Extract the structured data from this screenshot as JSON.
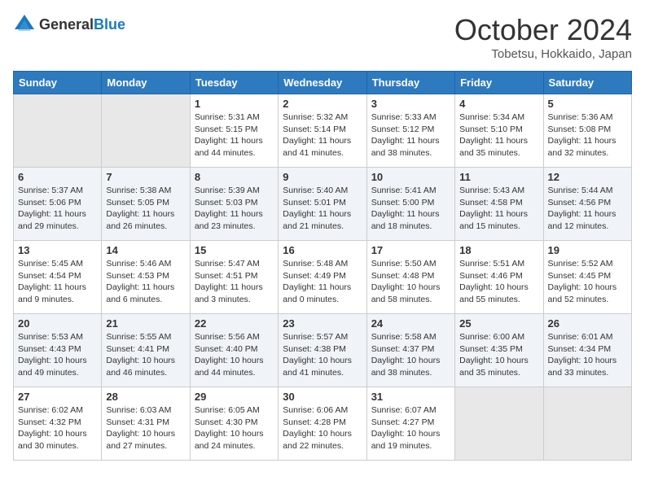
{
  "header": {
    "logo": {
      "general": "General",
      "blue": "Blue"
    },
    "title": "October 2024",
    "location": "Tobetsu, Hokkaido, Japan"
  },
  "weekdays": [
    "Sunday",
    "Monday",
    "Tuesday",
    "Wednesday",
    "Thursday",
    "Friday",
    "Saturday"
  ],
  "weeks": [
    [
      {
        "day": "",
        "info": ""
      },
      {
        "day": "",
        "info": ""
      },
      {
        "day": "1",
        "info": "Sunrise: 5:31 AM\nSunset: 5:15 PM\nDaylight: 11 hours and 44 minutes."
      },
      {
        "day": "2",
        "info": "Sunrise: 5:32 AM\nSunset: 5:14 PM\nDaylight: 11 hours and 41 minutes."
      },
      {
        "day": "3",
        "info": "Sunrise: 5:33 AM\nSunset: 5:12 PM\nDaylight: 11 hours and 38 minutes."
      },
      {
        "day": "4",
        "info": "Sunrise: 5:34 AM\nSunset: 5:10 PM\nDaylight: 11 hours and 35 minutes."
      },
      {
        "day": "5",
        "info": "Sunrise: 5:36 AM\nSunset: 5:08 PM\nDaylight: 11 hours and 32 minutes."
      }
    ],
    [
      {
        "day": "6",
        "info": "Sunrise: 5:37 AM\nSunset: 5:06 PM\nDaylight: 11 hours and 29 minutes."
      },
      {
        "day": "7",
        "info": "Sunrise: 5:38 AM\nSunset: 5:05 PM\nDaylight: 11 hours and 26 minutes."
      },
      {
        "day": "8",
        "info": "Sunrise: 5:39 AM\nSunset: 5:03 PM\nDaylight: 11 hours and 23 minutes."
      },
      {
        "day": "9",
        "info": "Sunrise: 5:40 AM\nSunset: 5:01 PM\nDaylight: 11 hours and 21 minutes."
      },
      {
        "day": "10",
        "info": "Sunrise: 5:41 AM\nSunset: 5:00 PM\nDaylight: 11 hours and 18 minutes."
      },
      {
        "day": "11",
        "info": "Sunrise: 5:43 AM\nSunset: 4:58 PM\nDaylight: 11 hours and 15 minutes."
      },
      {
        "day": "12",
        "info": "Sunrise: 5:44 AM\nSunset: 4:56 PM\nDaylight: 11 hours and 12 minutes."
      }
    ],
    [
      {
        "day": "13",
        "info": "Sunrise: 5:45 AM\nSunset: 4:54 PM\nDaylight: 11 hours and 9 minutes."
      },
      {
        "day": "14",
        "info": "Sunrise: 5:46 AM\nSunset: 4:53 PM\nDaylight: 11 hours and 6 minutes."
      },
      {
        "day": "15",
        "info": "Sunrise: 5:47 AM\nSunset: 4:51 PM\nDaylight: 11 hours and 3 minutes."
      },
      {
        "day": "16",
        "info": "Sunrise: 5:48 AM\nSunset: 4:49 PM\nDaylight: 11 hours and 0 minutes."
      },
      {
        "day": "17",
        "info": "Sunrise: 5:50 AM\nSunset: 4:48 PM\nDaylight: 10 hours and 58 minutes."
      },
      {
        "day": "18",
        "info": "Sunrise: 5:51 AM\nSunset: 4:46 PM\nDaylight: 10 hours and 55 minutes."
      },
      {
        "day": "19",
        "info": "Sunrise: 5:52 AM\nSunset: 4:45 PM\nDaylight: 10 hours and 52 minutes."
      }
    ],
    [
      {
        "day": "20",
        "info": "Sunrise: 5:53 AM\nSunset: 4:43 PM\nDaylight: 10 hours and 49 minutes."
      },
      {
        "day": "21",
        "info": "Sunrise: 5:55 AM\nSunset: 4:41 PM\nDaylight: 10 hours and 46 minutes."
      },
      {
        "day": "22",
        "info": "Sunrise: 5:56 AM\nSunset: 4:40 PM\nDaylight: 10 hours and 44 minutes."
      },
      {
        "day": "23",
        "info": "Sunrise: 5:57 AM\nSunset: 4:38 PM\nDaylight: 10 hours and 41 minutes."
      },
      {
        "day": "24",
        "info": "Sunrise: 5:58 AM\nSunset: 4:37 PM\nDaylight: 10 hours and 38 minutes."
      },
      {
        "day": "25",
        "info": "Sunrise: 6:00 AM\nSunset: 4:35 PM\nDaylight: 10 hours and 35 minutes."
      },
      {
        "day": "26",
        "info": "Sunrise: 6:01 AM\nSunset: 4:34 PM\nDaylight: 10 hours and 33 minutes."
      }
    ],
    [
      {
        "day": "27",
        "info": "Sunrise: 6:02 AM\nSunset: 4:32 PM\nDaylight: 10 hours and 30 minutes."
      },
      {
        "day": "28",
        "info": "Sunrise: 6:03 AM\nSunset: 4:31 PM\nDaylight: 10 hours and 27 minutes."
      },
      {
        "day": "29",
        "info": "Sunrise: 6:05 AM\nSunset: 4:30 PM\nDaylight: 10 hours and 24 minutes."
      },
      {
        "day": "30",
        "info": "Sunrise: 6:06 AM\nSunset: 4:28 PM\nDaylight: 10 hours and 22 minutes."
      },
      {
        "day": "31",
        "info": "Sunrise: 6:07 AM\nSunset: 4:27 PM\nDaylight: 10 hours and 19 minutes."
      },
      {
        "day": "",
        "info": ""
      },
      {
        "day": "",
        "info": ""
      }
    ]
  ]
}
